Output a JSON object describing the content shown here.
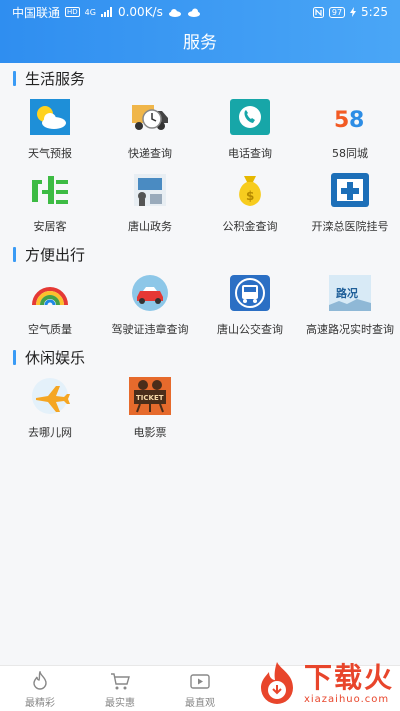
{
  "status_bar": {
    "carrier": "中国联通",
    "hd": "HD",
    "signal": "4G",
    "speed": "0.00K/s",
    "battery": "97",
    "time": "5:25"
  },
  "header": {
    "title": "服务"
  },
  "sections": [
    {
      "title": "生活服务",
      "items": [
        {
          "label": "天气预报",
          "icon": "weather-icon"
        },
        {
          "label": "快递查询",
          "icon": "delivery-truck-icon"
        },
        {
          "label": "电话查询",
          "icon": "phone-icon"
        },
        {
          "label": "58同城",
          "icon": "58-logo-icon"
        },
        {
          "label": "安居客",
          "icon": "anjuke-logo-icon"
        },
        {
          "label": "唐山政务",
          "icon": "government-service-icon"
        },
        {
          "label": "公积金查询",
          "icon": "money-bag-icon"
        },
        {
          "label": "开滦总医院挂号",
          "icon": "hospital-icon"
        }
      ]
    },
    {
      "title": "方便出行",
      "items": [
        {
          "label": "空气质量",
          "icon": "rainbow-icon"
        },
        {
          "label": "驾驶证违章查询",
          "icon": "car-icon"
        },
        {
          "label": "唐山公交查询",
          "icon": "bus-icon"
        },
        {
          "label": "高速路况实时查询",
          "icon": "road-condition-icon",
          "icon_text": "路况"
        }
      ]
    },
    {
      "title": "休闲娱乐",
      "items": [
        {
          "label": "去哪儿网",
          "icon": "airplane-icon"
        },
        {
          "label": "电影票",
          "icon": "movie-ticket-icon",
          "icon_text": "TICKET"
        }
      ]
    }
  ],
  "tabs": [
    {
      "label": "最精彩",
      "icon": "flame-icon"
    },
    {
      "label": "最实惠",
      "icon": "cart-icon"
    },
    {
      "label": "最直观",
      "icon": "video-icon"
    }
  ],
  "watermark": {
    "big": "下载火",
    "small": "xiazaihuo.com"
  },
  "colors": {
    "accent": "#3a9bf5",
    "header": "#2f8ef0",
    "watermark": "#e8452b"
  }
}
